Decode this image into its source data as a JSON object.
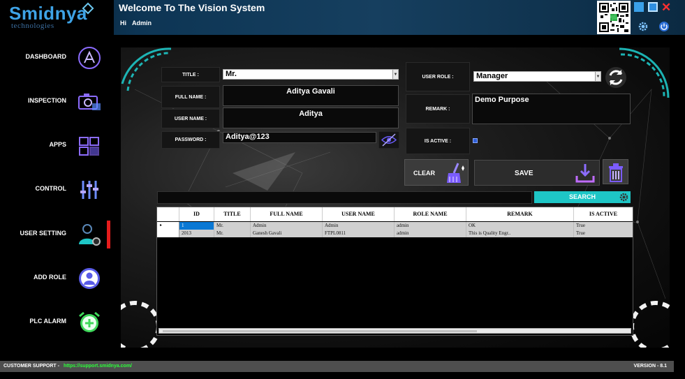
{
  "header": {
    "logo_text": "Smidnya",
    "logo_subtext": "technologies",
    "title": "Welcome To The Vision System",
    "greeting_hi": "Hi",
    "greeting_user": "Admin",
    "close_glyph": "✕"
  },
  "sidebar": {
    "items": [
      {
        "label": "DASHBOARD",
        "icon": "app-store-icon"
      },
      {
        "label": "INSPECTION",
        "icon": "camera-icon"
      },
      {
        "label": "APPS",
        "icon": "windows-icon"
      },
      {
        "label": "CONTROL",
        "icon": "sliders-icon"
      },
      {
        "label": "USER  SETTING",
        "icon": "user-settings-icon"
      },
      {
        "label": "ADD ROLE",
        "icon": "user-avatar-icon"
      },
      {
        "label": "PLC ALARM",
        "icon": "alarm-clock-icon"
      }
    ],
    "active_index": 4
  },
  "form": {
    "title_label": "TITLE :",
    "title_value": "Mr.",
    "fullname_label": "FULL NAME :",
    "fullname_value": "Aditya Gavali",
    "username_label": "USER NAME :",
    "username_value": "Aditya",
    "password_label": "PASSWORD :",
    "password_value": "Aditya@123",
    "role_label": "USER ROLE :",
    "role_value": "Manager",
    "remark_label": "REMARK :",
    "remark_value": "Demo Purpose",
    "active_label": "IS ACTIVE :",
    "is_active": true
  },
  "buttons": {
    "clear": "CLEAR",
    "save": "SAVE",
    "search": "SEARCH"
  },
  "grid": {
    "columns": [
      "ID",
      "TITLE",
      "FULL NAME",
      "USER NAME",
      "ROLE NAME",
      "REMARK",
      "IS ACTIVE"
    ],
    "rows": [
      {
        "marker": "▸",
        "id": "1",
        "title": "Mr.",
        "full_name": "Admin",
        "user_name": "Admin",
        "role_name": "admin",
        "remark": "OK",
        "is_active": "True"
      },
      {
        "marker": "",
        "id": "2013",
        "title": "Mr.",
        "full_name": "Ganesh Gavali",
        "user_name": "FTPL0811",
        "role_name": "admin",
        "remark": "This is Quality Engr..",
        "is_active": "True"
      }
    ]
  },
  "footer": {
    "support_label": "CUSTOMER SUPPORT -",
    "support_link": "https://support.smidnya.com/",
    "version": "VERSION - 8.1"
  },
  "colors": {
    "accent_cyan": "#1ec6c6",
    "active_red": "#e51c1c",
    "link_green": "#2bff3a",
    "icon_purple": "#7b5cff",
    "icon_blue": "#4f7df0",
    "alarm_green": "#3ed85a"
  }
}
